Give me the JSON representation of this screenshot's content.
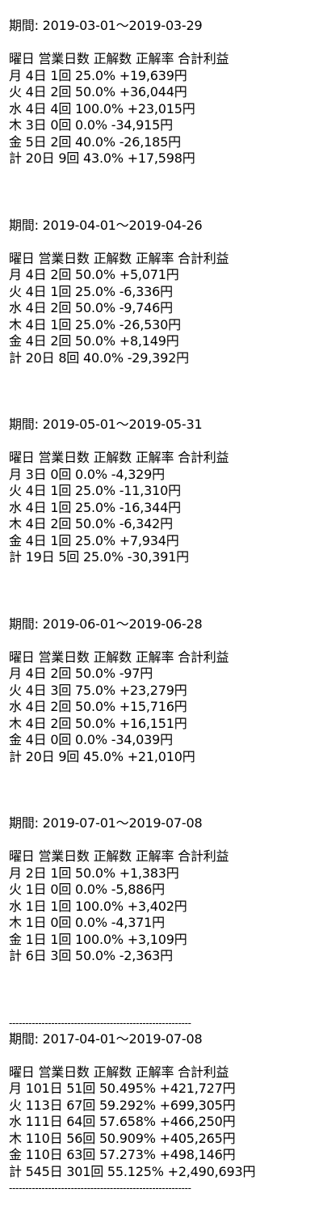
{
  "header_row": "曜日 営業日数 正解数 正解率 合計利益",
  "separator": "--------------------------------------------------------",
  "sections": [
    {
      "period": "期間: 2019-03-01〜2019-03-29",
      "rows": [
        "月 4日 1回 25.0% +19,639円",
        "火 4日 2回 50.0% +36,044円",
        "水 4日 4回 100.0% +23,015円",
        "木 3日 0回 0.0% -34,915円",
        "金 5日 2回 40.0% -26,185円",
        "計 20日 9回 43.0% +17,598円"
      ]
    },
    {
      "period": "期間: 2019-04-01〜2019-04-26",
      "rows": [
        "月 4日 2回 50.0% +5,071円",
        "火 4日 1回 25.0% -6,336円",
        "水 4日 2回 50.0% -9,746円",
        "木 4日 1回 25.0% -26,530円",
        "金 4日 2回 50.0% +8,149円",
        "計 20日 8回 40.0% -29,392円"
      ]
    },
    {
      "period": "期間: 2019-05-01〜2019-05-31",
      "rows": [
        "月 3日 0回 0.0% -4,329円",
        "火 4日 1回 25.0% -11,310円",
        "水 4日 1回 25.0% -16,344円",
        "木 4日 2回 50.0% -6,342円",
        "金 4日 1回 25.0% +7,934円",
        "計 19日 5回 25.0% -30,391円"
      ]
    },
    {
      "period": "期間: 2019-06-01〜2019-06-28",
      "rows": [
        "月 4日 2回 50.0% -97円",
        "火 4日 3回 75.0% +23,279円",
        "水 4日 2回 50.0% +15,716円",
        "木 4日 2回 50.0% +16,151円",
        "金 4日 0回 0.0% -34,039円",
        "計 20日 9回 45.0% +21,010円"
      ]
    },
    {
      "period": "期間: 2019-07-01〜2019-07-08",
      "rows": [
        "月 2日 1回 50.0% +1,383円",
        "火 1日 0回 0.0% -5,886円",
        "水 1日 1回 100.0% +3,402円",
        "木 1日 0回 0.0% -4,371円",
        "金 1日 1回 100.0% +3,109円",
        "計 6日 3回 50.0% -2,363円"
      ]
    },
    {
      "period": "期間: 2017-04-01〜2019-07-08",
      "rows": [
        "月 101日 51回 50.495% +421,727円",
        "火 113日 67回 59.292% +699,305円",
        "水 111日 64回 57.658% +466,250円",
        "木 110日 56回 50.909% +405,265円",
        "金 110日 63回 57.273% +498,146円",
        "計 545日 301回 55.125% +2,490,693円"
      ]
    }
  ]
}
